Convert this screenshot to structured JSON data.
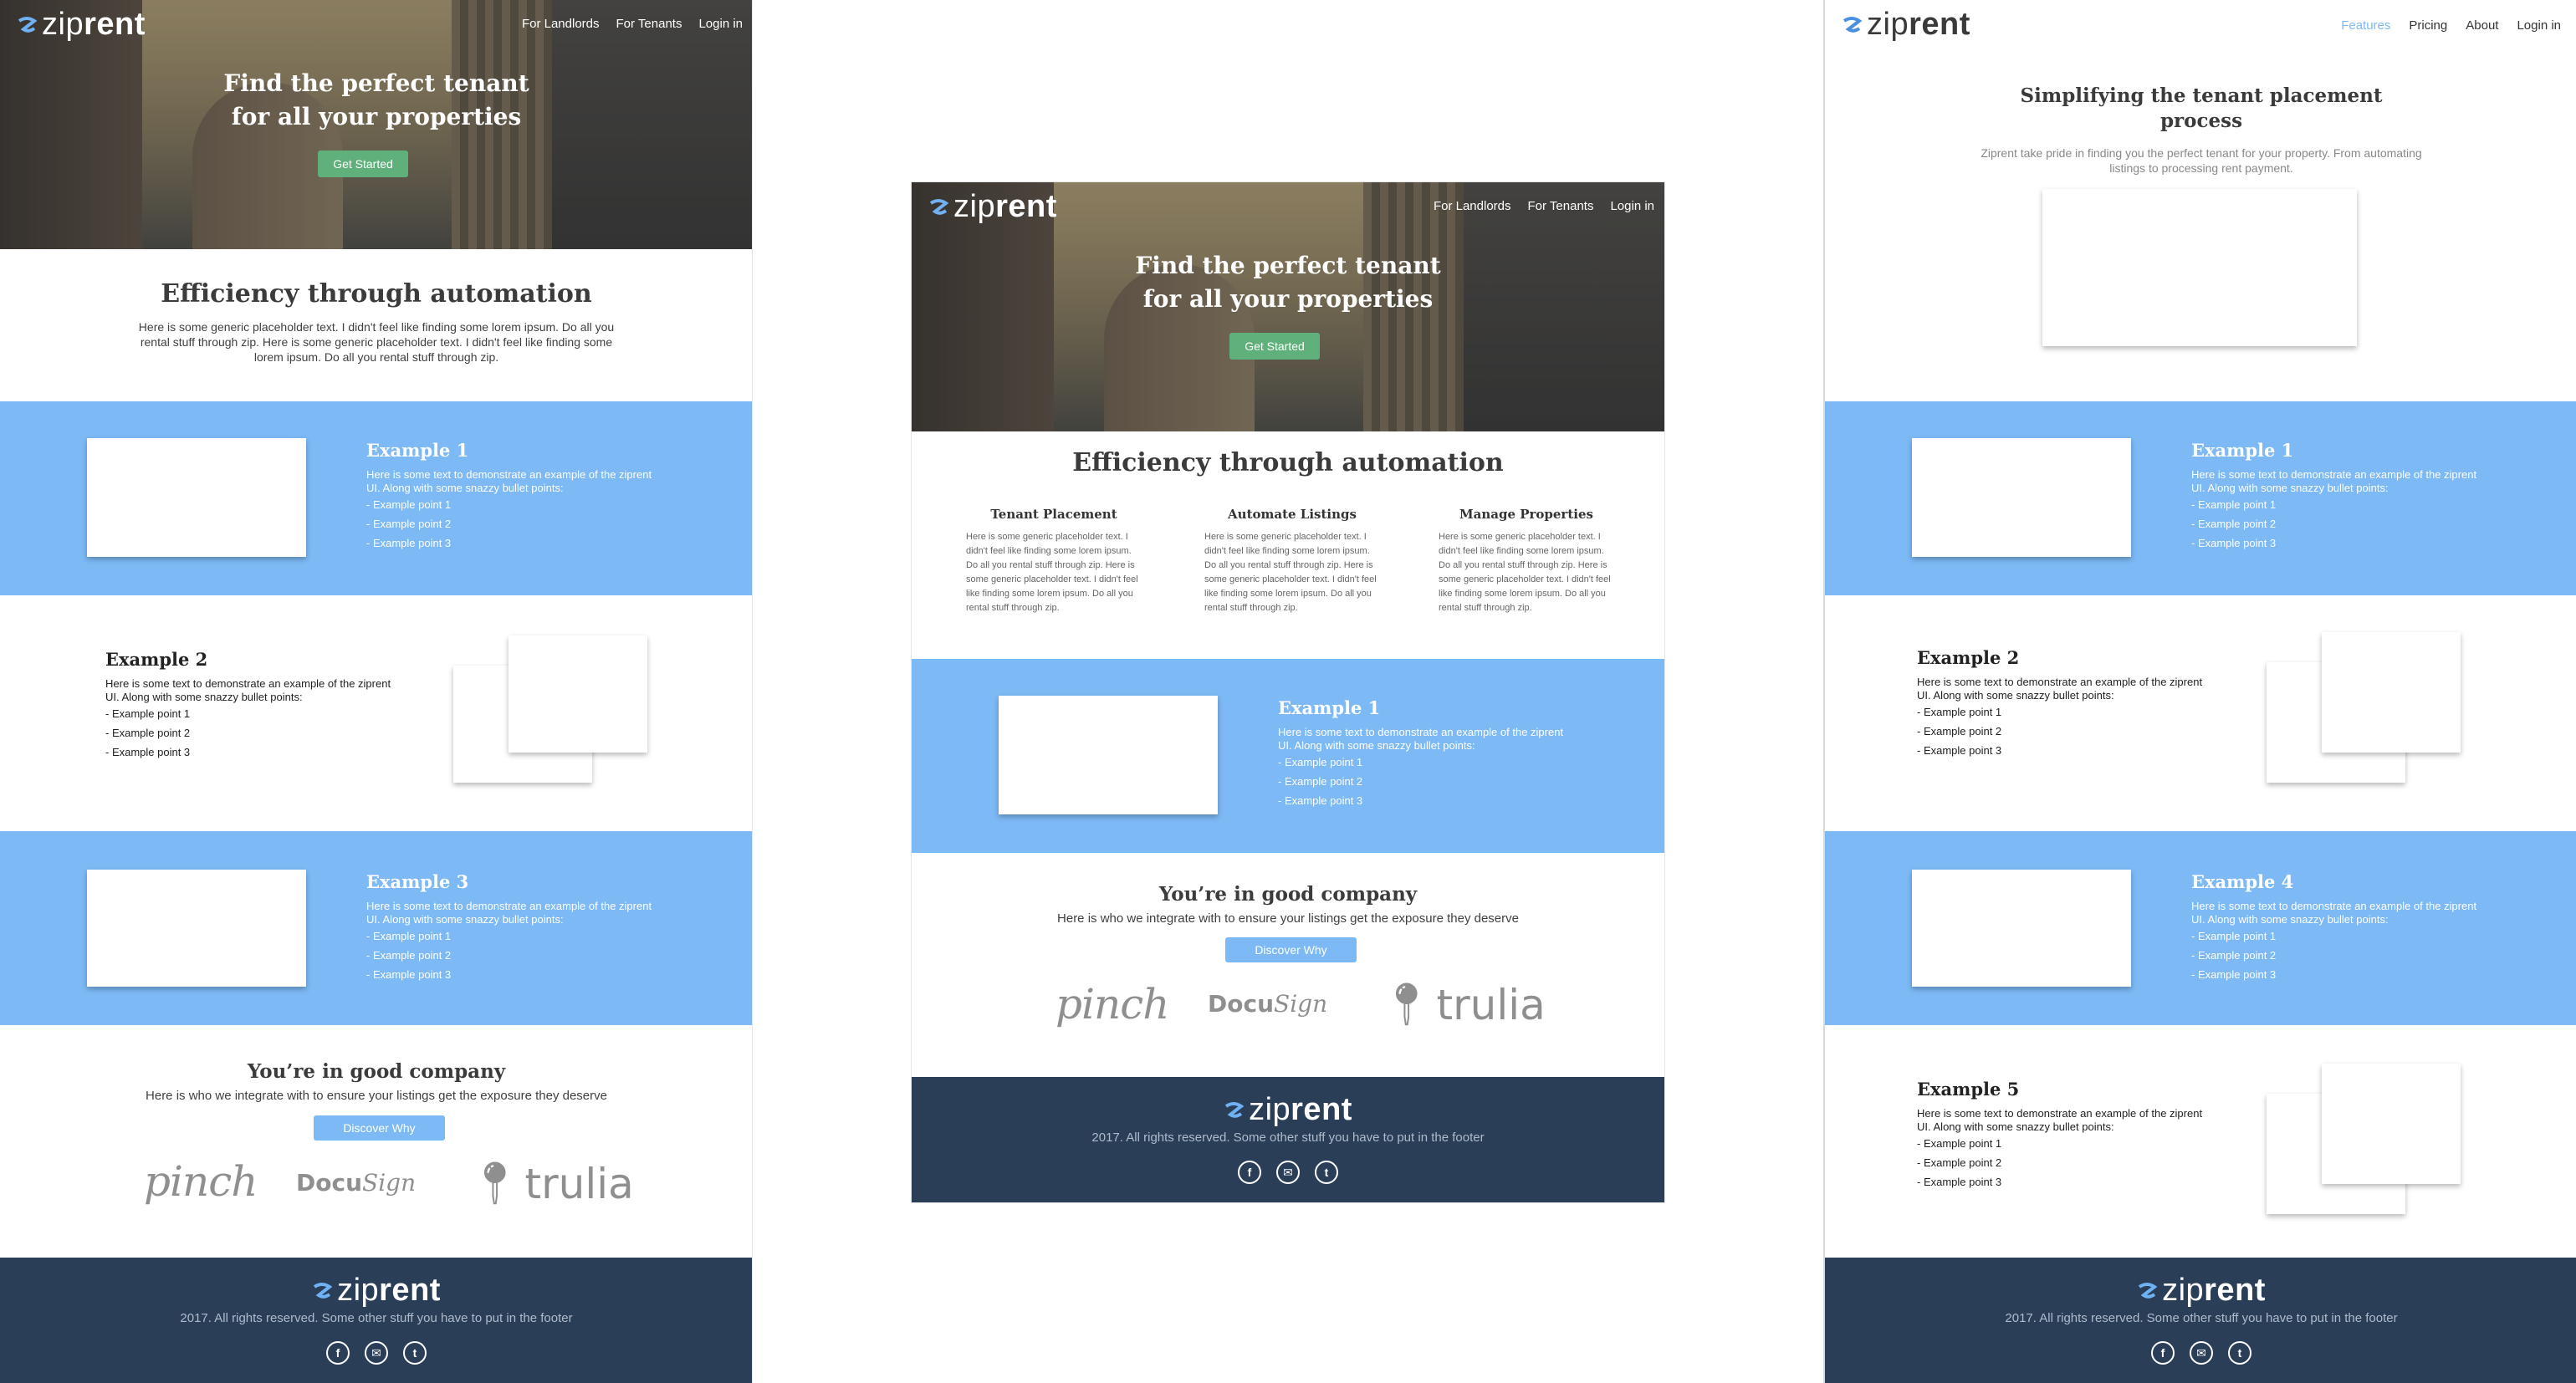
{
  "brand": {
    "zip": "zip",
    "rent": "rent",
    "accent": "#4a90e2"
  },
  "colors": {
    "band": "#7db9f5",
    "footer": "#2b3e58",
    "cta_green": "#5fb07a"
  },
  "hero": {
    "nav": [
      "For Landlords",
      "For Tenants",
      "Login in"
    ],
    "title_line1": "Find the perfect tenant",
    "title_line2": "for all your properties",
    "cta": "Get Started"
  },
  "efficiency": {
    "title": "Efficiency through automation",
    "text": "Here is some generic placeholder text. I didn't feel like finding some lorem ipsum. Do all you rental stuff through zip. Here is some generic placeholder text. I didn't feel like finding some lorem ipsum. Do all you rental stuff through zip."
  },
  "example_text": "Here is some text to demonstrate an example of the ziprent UI. Along with some snazzy bullet points:",
  "example_points": [
    "- Example point 1",
    "- Example point 2",
    "- Example point 3"
  ],
  "examples": {
    "e1": "Example 1",
    "e2": "Example 2",
    "e3": "Example 3",
    "e4": "Example 4",
    "e5": "Example 5"
  },
  "features": [
    {
      "title": "Tenant Placement",
      "text": "Here is some generic placeholder text. I didn't feel like finding some lorem ipsum. Do all you rental stuff through zip. Here is some generic placeholder text. I didn't feel like finding some lorem ipsum. Do all you rental stuff through zip."
    },
    {
      "title": "Automate Listings",
      "text": "Here is some generic placeholder text. I didn't feel like finding some lorem ipsum. Do all you rental stuff through zip. Here is some generic placeholder text. I didn't feel like finding some lorem ipsum. Do all you rental stuff through zip."
    },
    {
      "title": "Manage Properties",
      "text": "Here is some generic placeholder text. I didn't feel like finding some lorem ipsum. Do all you rental stuff through zip. Here is some generic placeholder text. I didn't feel like finding some lorem ipsum. Do all you rental stuff through zip."
    }
  ],
  "company": {
    "title": "You’re in good company",
    "text": "Here is who we integrate with to ensure your listings get the exposure they deserve",
    "cta": "Discover Why",
    "partners": {
      "pinch": "pinch",
      "docu_a": "Docu",
      "docu_b": "Sign",
      "trulia": "trulia"
    }
  },
  "footer": {
    "text": "2017. All rights reserved. Some other stuff you have to put in the footer",
    "icons": [
      "facebook-icon",
      "mail-icon",
      "twitter-icon"
    ]
  },
  "features_page": {
    "nav": [
      "Features",
      "Pricing",
      "About",
      "Login in"
    ],
    "title_line1": "Simplifying the tenant placement",
    "title_line2": "process",
    "subtitle_line1": "Ziprent take pride in finding you the perfect tenant for your property. From automating",
    "subtitle_line2": "listings to processing rent payment."
  }
}
